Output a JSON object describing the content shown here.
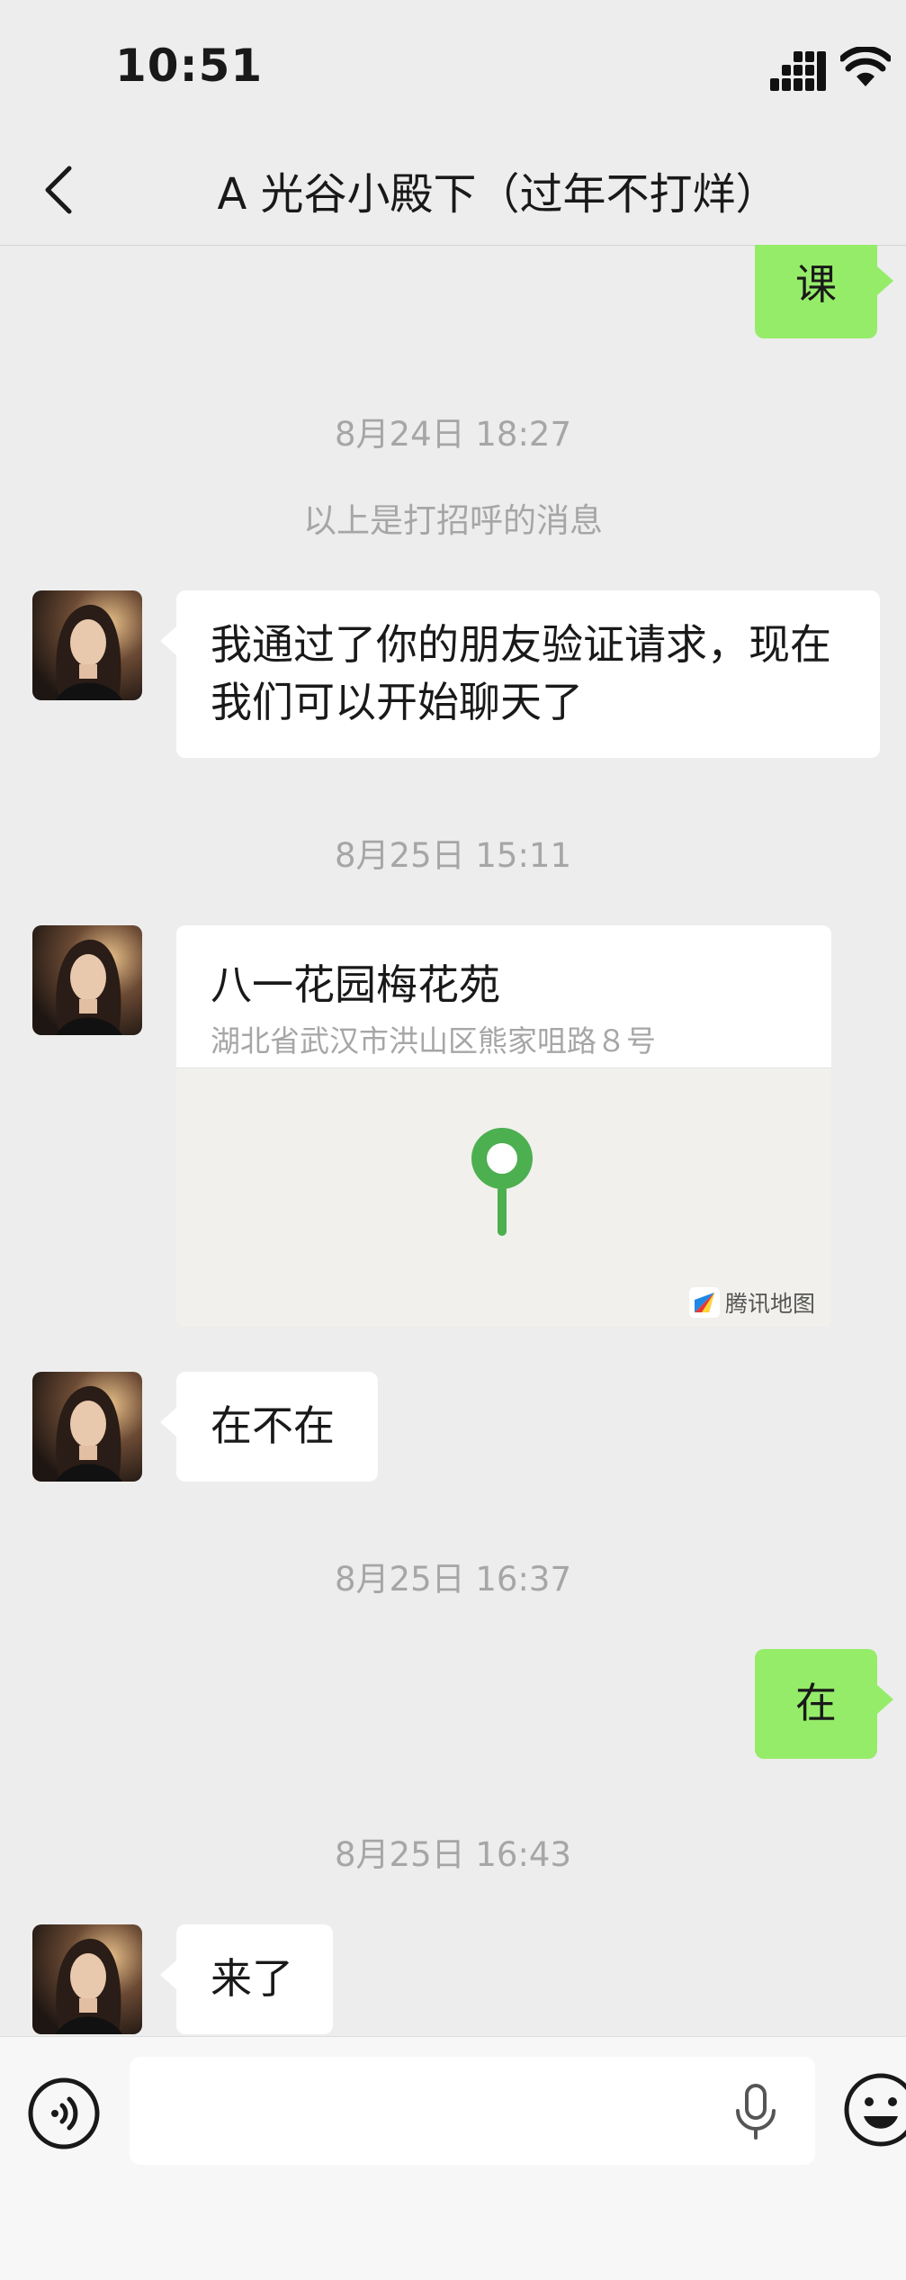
{
  "status_bar": {
    "time": "10:51"
  },
  "nav": {
    "title": "A 光谷小殿下（过年不打烊）"
  },
  "messages": {
    "m0_text": "课",
    "ts1": "8月24日 18:27",
    "system_note": "以上是打招呼的消息",
    "m1_text": "我通过了你的朋友验证请求，现在我们可以开始聊天了",
    "ts2": "8月25日 15:11",
    "location": {
      "title": "八一花园梅花苑",
      "address": "湖北省武汉市洪山区熊家咀路８号",
      "map_brand": "腾讯地图"
    },
    "m3_text": "在不在",
    "ts3": "8月25日 16:37",
    "m4_text": "在",
    "ts4": "8月25日 16:43",
    "m5_text": "来了"
  },
  "input": {
    "placeholder": ""
  },
  "colors": {
    "background": "#EDEDED",
    "sent_bubble": "#95EC69",
    "received_bubble": "#FFFFFF",
    "timestamp": "#A6A6A6",
    "map_pin": "#4CAF50"
  },
  "icons": {
    "back": "chevron-left-icon",
    "voice": "voice-icon",
    "mic": "microphone-icon",
    "emoji": "emoji-icon",
    "pin": "map-pin-icon"
  }
}
